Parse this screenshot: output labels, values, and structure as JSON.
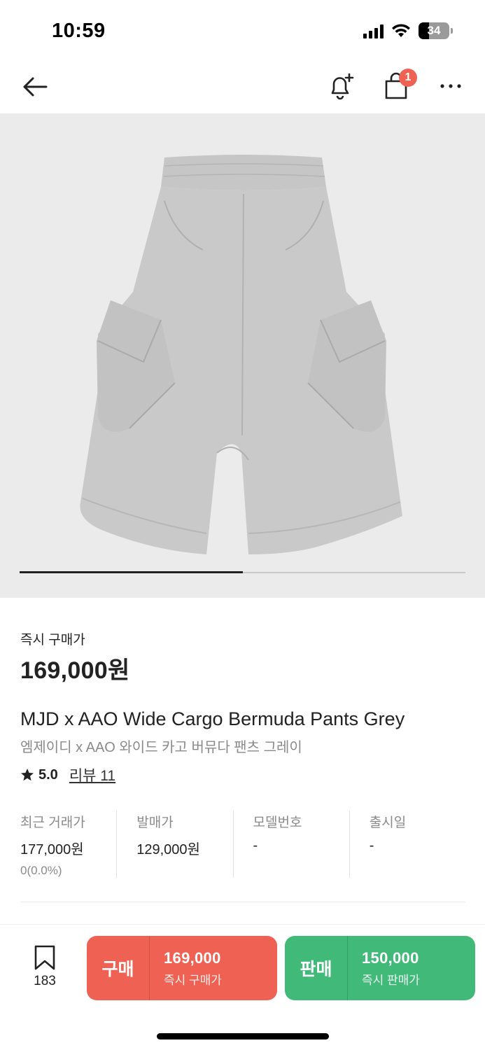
{
  "status_bar": {
    "time": "10:59",
    "battery": "34",
    "icons": [
      "signal-icon",
      "wifi-icon",
      "battery-icon"
    ]
  },
  "nav": {
    "back_icon": "back-arrow-icon",
    "bell_icon": "notification-add-icon",
    "bag_icon": "shopping-bag-icon",
    "bag_badge": "1",
    "more_icon": "more-icon"
  },
  "product": {
    "image_alt": "grey cargo bermuda shorts",
    "pager_progress": 0.5,
    "price_label": "즉시 구매가",
    "price": "169,000원",
    "title_en": "MJD x AAO Wide Cargo Bermuda Pants Grey",
    "title_ko": "엠제이디 x AAO 와이드 카고 버뮤다 팬츠 그레이",
    "rating": "5.0",
    "review_label": "리뷰 11"
  },
  "info": [
    {
      "label": "최근 거래가",
      "value": "177,000원",
      "sub": "0(0.0%)"
    },
    {
      "label": "발매가",
      "value": "129,000원",
      "sub": ""
    },
    {
      "label": "모델번호",
      "value": "-",
      "sub": ""
    },
    {
      "label": "출시일",
      "value": "-",
      "sub": ""
    }
  ],
  "actions": {
    "wish_count": "183",
    "buy_label": "구매",
    "buy_price": "169,000",
    "buy_sub": "즉시 구매가",
    "sell_label": "판매",
    "sell_price": "150,000",
    "sell_sub": "즉시 판매가"
  },
  "colors": {
    "buy": "#ef6253",
    "sell": "#41b979",
    "image_bg": "#ebebeb"
  }
}
